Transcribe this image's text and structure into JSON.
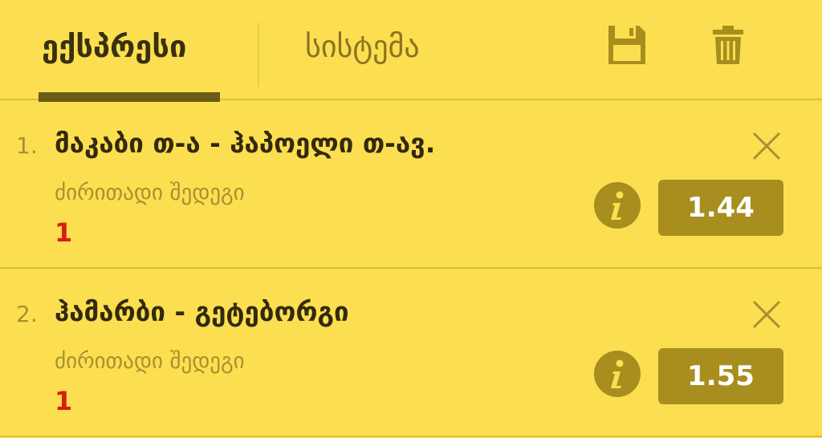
{
  "tabs": [
    {
      "label": "ექსპრესი",
      "active": true
    },
    {
      "label": "სისტემა",
      "active": false
    }
  ],
  "icons": {
    "save": "floppy-disk-icon",
    "delete": "trash-icon",
    "close": "close-icon",
    "info": "info-icon"
  },
  "colors": {
    "background": "#fbdf50",
    "accent": "#a88e1e",
    "pick": "#d81e10"
  },
  "bets": [
    {
      "index": "1.",
      "title": "მაკაბი თ-ა - ჰაპოელი თ-ავ.",
      "market": "ძირითადი შედეგი",
      "pick": "1",
      "odds": "1.44"
    },
    {
      "index": "2.",
      "title": "ჰამარბი - გეტებორგი",
      "market": "ძირითადი შედეგი",
      "pick": "1",
      "odds": "1.55"
    }
  ]
}
